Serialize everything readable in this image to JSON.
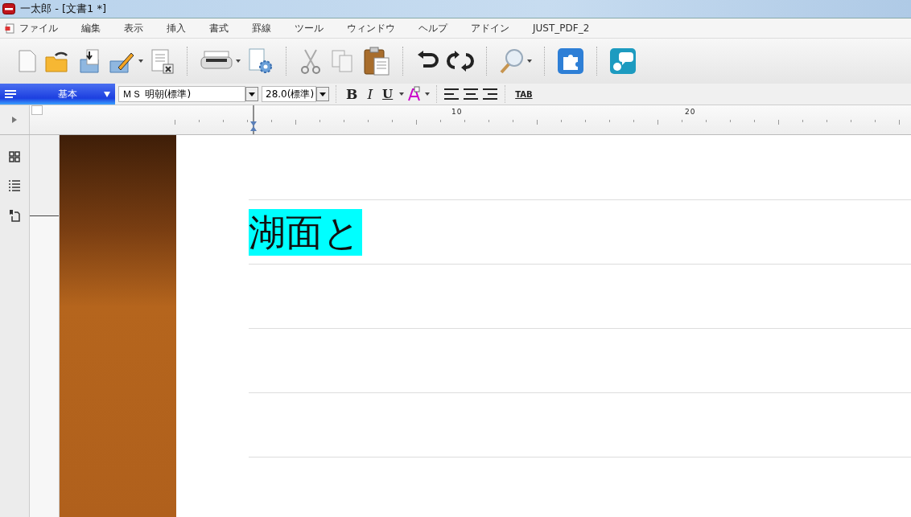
{
  "window": {
    "title": "一太郎 - [文書1 *]"
  },
  "menu": [
    "ファイル",
    "編集",
    "表示",
    "挿入",
    "書式",
    "罫線",
    "ツール",
    "ウィンドウ",
    "ヘルプ",
    "アドイン",
    "JUST_PDF_2"
  ],
  "format_bar": {
    "style": "基本",
    "font": "ＭＳ 明朝(標準)",
    "size": "28.0(標準)",
    "bold": "B",
    "italic": "I",
    "underline": "U",
    "tab": "TAB"
  },
  "ruler": {
    "labels": [
      "10",
      "20"
    ]
  },
  "document": {
    "lines": [
      {
        "text": "湖面と",
        "highlighted": true
      }
    ]
  }
}
